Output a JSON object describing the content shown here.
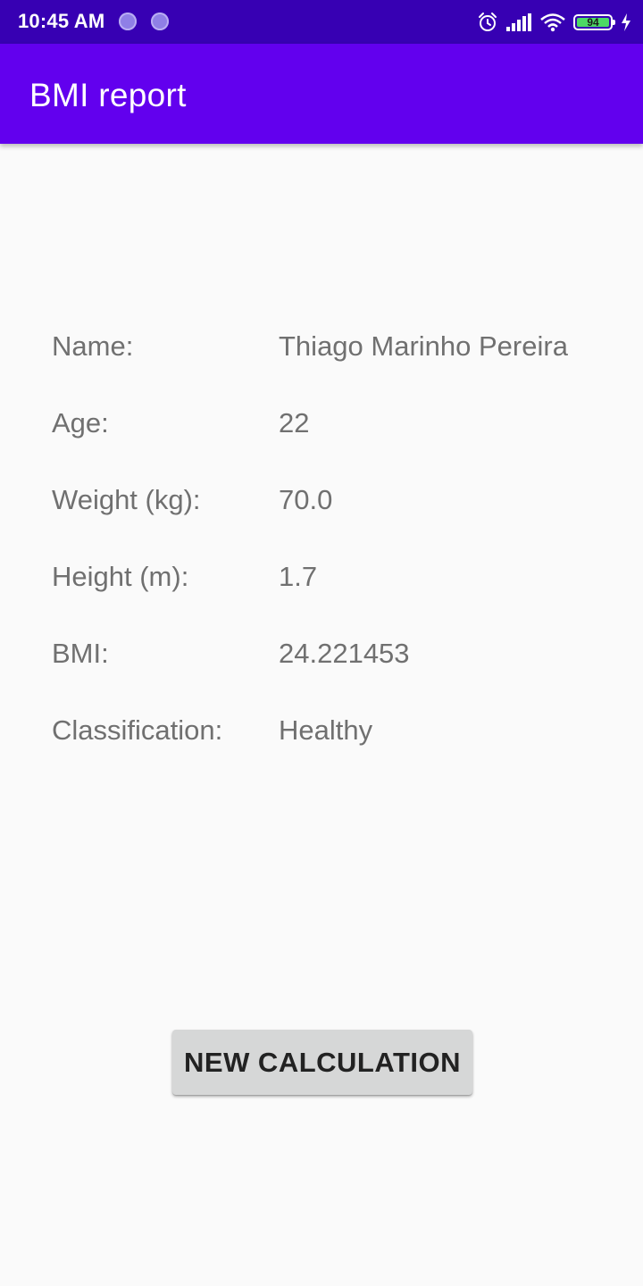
{
  "status_bar": {
    "time": "10:45 AM",
    "battery_level": "94",
    "icons": [
      "notification-dot-icon",
      "notification-dot-icon",
      "alarm-icon",
      "signal-icon",
      "wifi-icon",
      "battery-icon",
      "charging-icon"
    ],
    "battery_color": "#4cd964"
  },
  "app_bar": {
    "title": "BMI report",
    "color": "#6200ee"
  },
  "report": {
    "rows": [
      {
        "label": "Name:",
        "value": "Thiago Marinho Pereira"
      },
      {
        "label": "Age:",
        "value": "22"
      },
      {
        "label": "Weight (kg):",
        "value": "70.0"
      },
      {
        "label": "Height (m):",
        "value": "1.7"
      },
      {
        "label": "BMI:",
        "value": "24.221453"
      },
      {
        "label": "Classification:",
        "value": "Healthy"
      }
    ]
  },
  "actions": {
    "new_calculation_label": "NEW CALCULATION"
  }
}
